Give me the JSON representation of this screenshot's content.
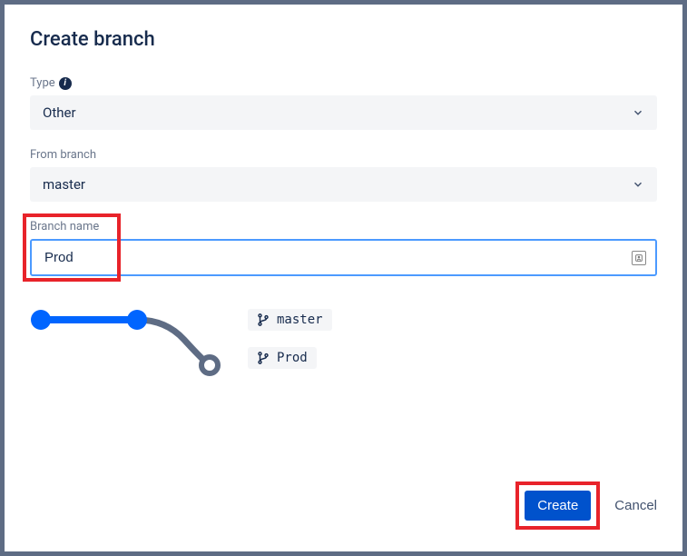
{
  "title": "Create branch",
  "fields": {
    "type": {
      "label": "Type",
      "value": "Other"
    },
    "from_branch": {
      "label": "From branch",
      "value": "master"
    },
    "branch_name": {
      "label": "Branch name",
      "value": "Prod"
    }
  },
  "viz": {
    "source_label": "master",
    "target_label": "Prod"
  },
  "buttons": {
    "create": "Create",
    "cancel": "Cancel"
  }
}
